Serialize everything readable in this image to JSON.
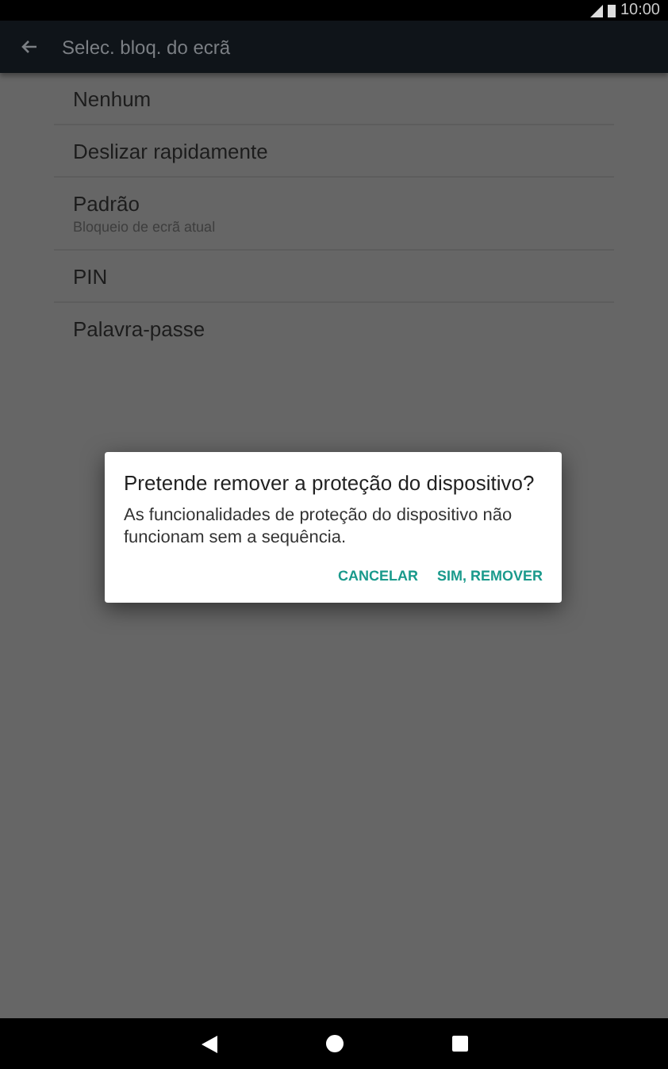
{
  "status_bar": {
    "time": "10:00"
  },
  "app_bar": {
    "title": "Selec. bloq. do ecrã"
  },
  "options": [
    {
      "title": "Nenhum"
    },
    {
      "title": "Deslizar rapidamente"
    },
    {
      "title": "Padrão",
      "subtitle": "Bloqueio de ecrã atual"
    },
    {
      "title": "PIN"
    },
    {
      "title": "Palavra-passe"
    }
  ],
  "dialog": {
    "title": "Pretende remover a proteção do dispositivo?",
    "message": "As funcionalidades de proteção do dispositivo não funcionam sem a sequência.",
    "buttons": [
      "CANCELAR",
      "SIM, REMOVER"
    ]
  }
}
